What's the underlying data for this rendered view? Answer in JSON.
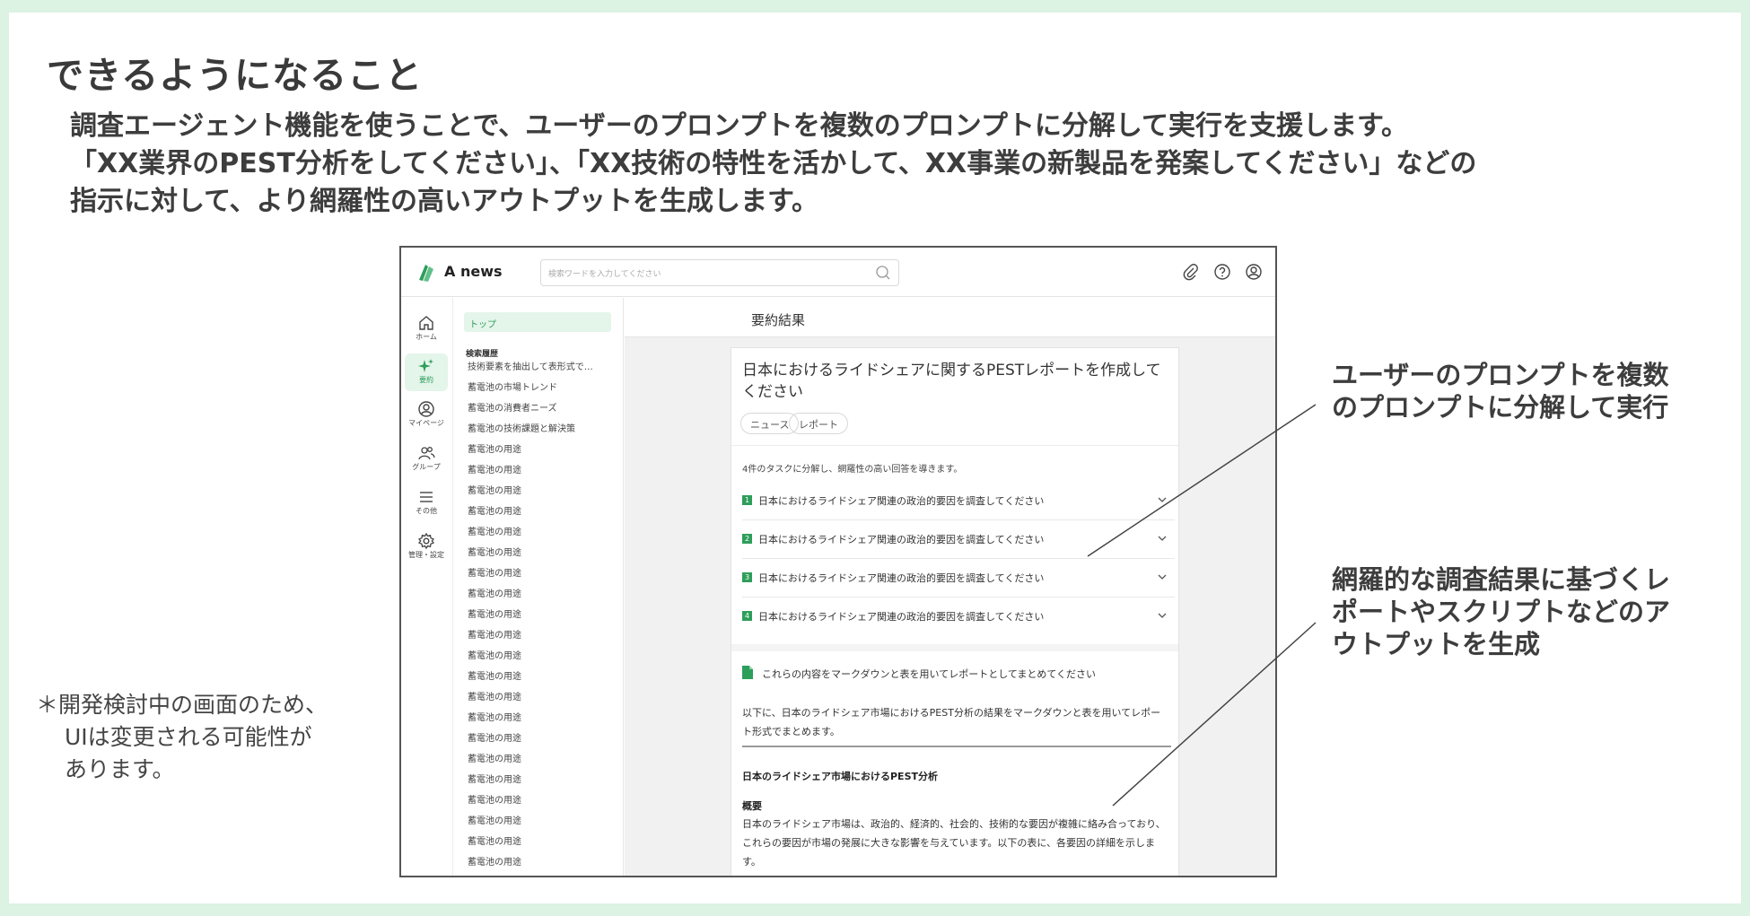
{
  "slide": {
    "title": "できるようになること",
    "intro_lines": [
      "調査エージェント機能を使うことで、ユーザーのプロンプトを複数のプロンプトに分解して実行を支援します。",
      "「XX業界のPEST分析をしてください」、「XX技術の特性を活かして、XX事業の新製品を発案してください」などの",
      "指示に対して、より網羅性の高いアウトプットを生成します。"
    ],
    "callout_1": [
      "ユーザーのプロンプトを複数",
      "のプロンプトに分解して実行"
    ],
    "callout_2": [
      "網羅的な調査結果に基づくレ",
      "ポートやスクリプトなどのア",
      "ウトプットを生成"
    ],
    "note": [
      "＊開発検討中の画面のため、",
      "UIは変更される可能性が",
      "あります。"
    ]
  },
  "app": {
    "logo_text": "A news",
    "brand_color": "#2e9e5b",
    "search_placeholder": "検索ワードを入力してください",
    "top_icons": [
      "paperclip-icon",
      "help-icon",
      "account-icon"
    ],
    "rail": [
      {
        "icon": "home-icon",
        "label": "ホーム"
      },
      {
        "icon": "sparkle-icon",
        "label": "要約",
        "active": true
      },
      {
        "icon": "mypage-icon",
        "label": "マイページ"
      },
      {
        "icon": "group-icon",
        "label": "グループ"
      },
      {
        "icon": "menu-icon",
        "label": "その他"
      },
      {
        "icon": "gear-icon",
        "label": "管理・設定"
      }
    ],
    "history": {
      "top_label": "トップ",
      "heading": "検索履歴",
      "items": [
        "技術要素を抽出して表形式で…",
        "蓄電池の市場トレンド",
        "蓄電池の消費者ニーズ",
        "蓄電池の技術課題と解決策",
        "蓄電池の用途",
        "蓄電池の用途",
        "蓄電池の用途",
        "蓄電池の用途",
        "蓄電池の用途",
        "蓄電池の用途",
        "蓄電池の用途",
        "蓄電池の用途",
        "蓄電池の用途",
        "蓄電池の用途",
        "蓄電池の用途",
        "蓄電池の用途",
        "蓄電池の用途",
        "蓄電池の用途",
        "蓄電池の用途",
        "蓄電池の用途",
        "蓄電池の用途",
        "蓄電池の用途",
        "蓄電池の用途",
        "蓄電池の用途",
        "蓄電池の用途",
        "蓄電池の用途"
      ]
    },
    "main": {
      "title": "要約結果",
      "request": "日本におけるライドシェアに関するPESTレポートを作成してください",
      "tags": [
        "ニュース",
        "レポート"
      ],
      "task_intro": "4件のタスクに分解し、網羅性の高い回答を導きます。",
      "tasks": [
        {
          "num": "1",
          "text": "日本におけるライドシェア関連の政治的要因を調査してください"
        },
        {
          "num": "2",
          "text": "日本におけるライドシェア関連の政治的要因を調査してください"
        },
        {
          "num": "3",
          "text": "日本におけるライドシェア関連の政治的要因を調査してください"
        },
        {
          "num": "4",
          "text": "日本におけるライドシェア関連の政治的要因を調査してください"
        }
      ],
      "followup": "これらの内容をマークダウンと表を用いてレポートとしてまとめてください",
      "answer_intro": "以下に、日本のライドシェア市場におけるPEST分析の結果をマークダウンと表を用いてレポート形式でまとめます。",
      "answer_heading": "日本のライドシェア市場におけるPEST分析",
      "answer_subheading": "概要",
      "answer_body": "日本のライドシェア市場は、政治的、経済的、社会的、技術的な要因が複雑に絡み合っており、これらの要因が市場の発展に大きな影響を与えています。以下の表に、各要因の詳細を示します。"
    }
  }
}
